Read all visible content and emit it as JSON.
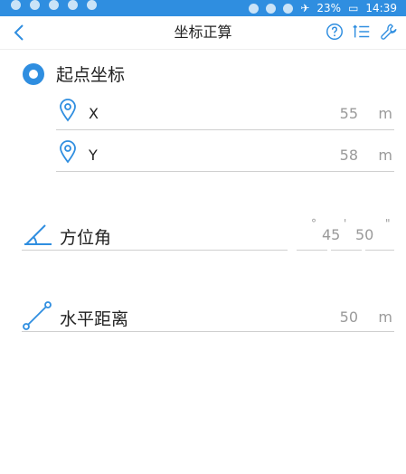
{
  "status": {
    "battery": "23%",
    "time": "14:39"
  },
  "nav": {
    "title": "坐标正算"
  },
  "start_point": {
    "title": "起点坐标",
    "x": {
      "label": "X",
      "value": "55",
      "unit": "m"
    },
    "y": {
      "label": "Y",
      "value": "58",
      "unit": "m"
    }
  },
  "azimuth": {
    "label": "方位角",
    "deg_symbol": "°",
    "deg": "45",
    "min_symbol": "'",
    "min": "50",
    "sec_symbol": "\""
  },
  "distance": {
    "label": "水平距离",
    "value": "50",
    "unit": "m"
  },
  "colors": {
    "accent": "#2f8ee0"
  }
}
